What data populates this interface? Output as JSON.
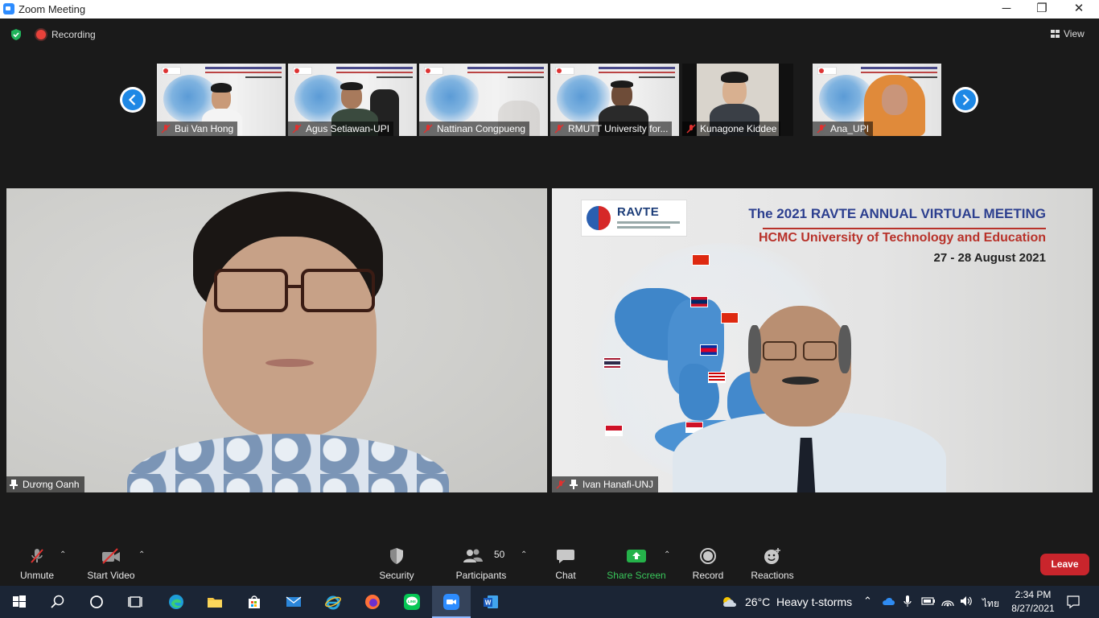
{
  "window": {
    "title": "Zoom Meeting",
    "controls": {
      "minimize": "─",
      "restore": "❐",
      "close": "✕"
    }
  },
  "status": {
    "recording_label": "Recording",
    "view_label": "View",
    "shield_color": "#21b35b",
    "record_color": "#e8413a"
  },
  "gallery": {
    "thumbnails": [
      {
        "name": "Bui Van Hong",
        "muted": true
      },
      {
        "name": "Agus Setiawan-UPI",
        "muted": true
      },
      {
        "name": "Nattinan Congpueng",
        "muted": true
      },
      {
        "name": "RMUTT University for...",
        "muted": true
      },
      {
        "name": "Kunagone Kiddee",
        "muted": true
      },
      {
        "name": "Ana_UPI",
        "muted": true
      }
    ]
  },
  "main_tiles": {
    "left": {
      "name": "Dương Oanh",
      "pinned": true,
      "muted": false
    },
    "right": {
      "name": "Ivan Hanafi-UNJ",
      "pinned": true,
      "muted": true,
      "slide": {
        "logo_text": "RAVTE",
        "title": "The 2021 RAVTE ANNUAL VIRTUAL MEETING",
        "subtitle": "HCMC University of Technology and Education",
        "date": "27 - 28 August 2021"
      }
    }
  },
  "toolbar": {
    "unmute": "Unmute",
    "start_video": "Start Video",
    "security": "Security",
    "participants": "Participants",
    "participants_count": "50",
    "chat": "Chat",
    "share_screen": "Share Screen",
    "record": "Record",
    "reactions": "Reactions",
    "leave": "Leave",
    "share_color": "#25b24a",
    "leave_color": "#c9252c"
  },
  "taskbar": {
    "apps": [
      "start-icon",
      "search-icon",
      "cortana-icon",
      "task-view-icon",
      "edge-icon",
      "file-explorer-icon",
      "store-icon",
      "mail-icon",
      "internet-explorer-icon",
      "firefox-icon",
      "line-icon",
      "zoom-icon",
      "word-icon"
    ],
    "weather_temp": "26°C",
    "weather_desc": "Heavy t-storms",
    "language": "ไทย",
    "time": "2:34 PM",
    "date": "8/27/2021"
  }
}
